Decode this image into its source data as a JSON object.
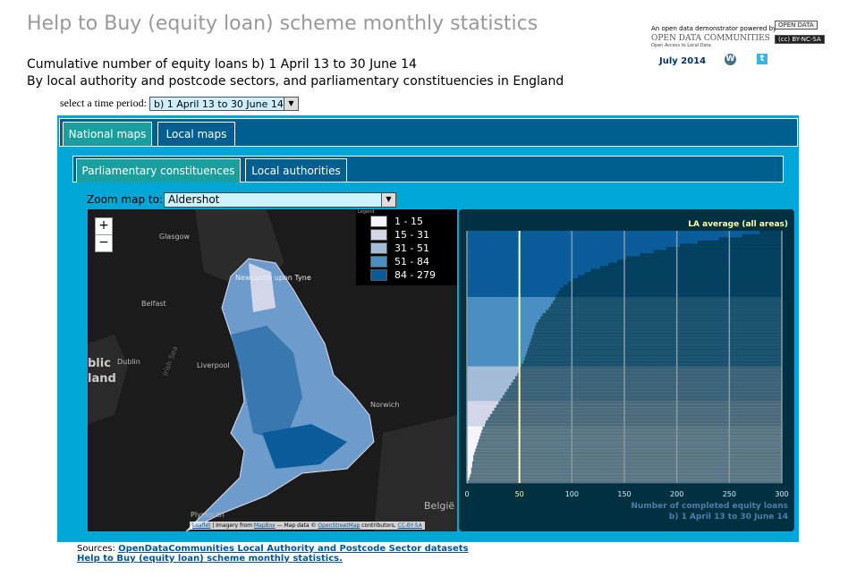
{
  "header": {
    "title": "Help to Buy (equity loan) scheme monthly statistics",
    "subtitle1": "Cumulative number of equity loans b) 1 April 13 to 30 June 14",
    "subtitle2": "By local authority and postcode sectors, and parliamentary constituencies in England",
    "powered_by": "An open data demonstrator powered by",
    "brand": "OPEN DATA COMMUNITIES",
    "brand_tag": "Open Access to Local Data",
    "badge_open": "OPEN DATA",
    "badge_cc": "(cc) BY-NC-SA",
    "date": "July 2014",
    "icons": [
      "wordpress-icon",
      "twitter-icon"
    ]
  },
  "time_period": {
    "label": "select a time period:",
    "value": "b) 1 April 13 to 30 June 14"
  },
  "tabs": [
    {
      "label": "National maps",
      "active": true
    },
    {
      "label": "Local maps",
      "active": false
    }
  ],
  "subtabs": [
    {
      "label": "Parliamentary constituences",
      "active": true
    },
    {
      "label": "Local authorities",
      "active": false
    }
  ],
  "zoom": {
    "label": "Zoom map to:",
    "value": "Aldershot"
  },
  "map": {
    "legend_title": "Legend",
    "legend": [
      {
        "label": "1 - 15",
        "color": "#f7f4fb"
      },
      {
        "label": "15 - 31",
        "color": "#d4d6ea"
      },
      {
        "label": "31 - 51",
        "color": "#a5bcd9"
      },
      {
        "label": "51 - 84",
        "color": "#4a8fc2"
      },
      {
        "label": "84 - 279",
        "color": "#0b5c9b"
      }
    ],
    "places": [
      "Glasgow",
      "Belfast",
      "Dublin",
      "Liverpool",
      "Irish Sea",
      "Newcastle upon Tyne",
      "Norwich",
      "Plymouth",
      "België",
      "blic",
      "land"
    ],
    "attribution": {
      "leaflet": "Leaflet",
      "imagery": " | Imagery from ",
      "mapbox": "MapBox",
      "mapdata": " — Map data © ",
      "osm": "OpenStreetMap",
      "contrib": " contributors, ",
      "cc": "CC-BY-SA"
    }
  },
  "chart_data": {
    "type": "bar",
    "orientation": "horizontal",
    "sorted": "descending",
    "annotation": "LA average (all areas)",
    "average": 50,
    "xlabel": "Number of completed equity loans",
    "xlabel2": "b) 1 April 13 to 30 June 14",
    "xlim": [
      0,
      300
    ],
    "xticks": [
      "0",
      "50",
      "100",
      "150",
      "200",
      "250",
      "300"
    ],
    "values": [
      279,
      262,
      240,
      220,
      203,
      190,
      178,
      165,
      152,
      143,
      135,
      127,
      118,
      112,
      106,
      100,
      96,
      92,
      89,
      87,
      85,
      84,
      82,
      80,
      78,
      75,
      72,
      70,
      68,
      66,
      65,
      64,
      63,
      62,
      61,
      60,
      59,
      58,
      57,
      56,
      55,
      54,
      52,
      50,
      49,
      48,
      46,
      44,
      42,
      40,
      38,
      36,
      34,
      32,
      30,
      28,
      26,
      24,
      22,
      20,
      18,
      17,
      15,
      14,
      13,
      12,
      11,
      10,
      9,
      8,
      7,
      6,
      6,
      5,
      5,
      4,
      4,
      3,
      2,
      1
    ]
  },
  "sources": {
    "label": "Sources: ",
    "link1": "OpenDataCommunities Local Authority and Postcode Sector datasets",
    "link2": "Help to Buy (equity loan) scheme monthly statistics."
  }
}
